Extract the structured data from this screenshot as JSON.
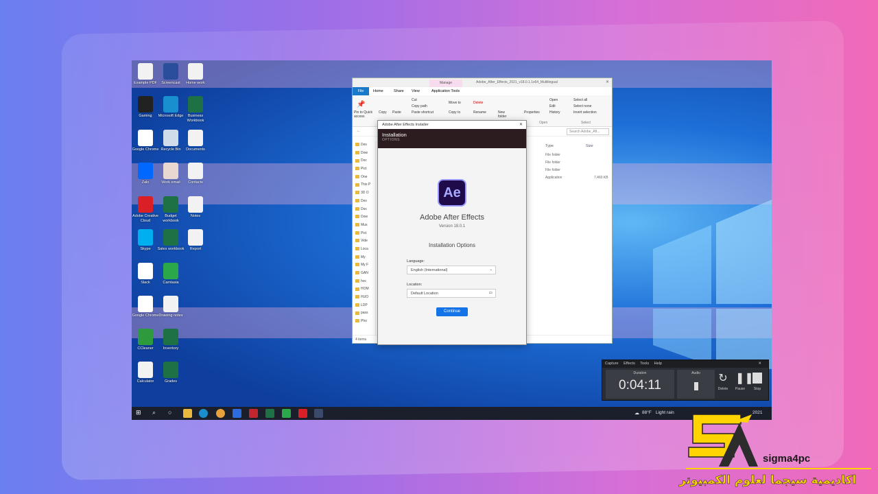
{
  "desktop": {
    "icons": [
      {
        "label": "Example PDF",
        "color": "#f2f2f2"
      },
      {
        "label": "Screencast",
        "color": "#2a4d9c"
      },
      {
        "label": "Home work",
        "color": "#f2f2f2"
      },
      {
        "label": "Gaming",
        "color": "#222222"
      },
      {
        "label": "Microsoft Edge",
        "color": "#1a8fd0"
      },
      {
        "label": "Business Workbook",
        "color": "#1e7145"
      },
      {
        "label": "Google Chrome",
        "color": "#ffffff"
      },
      {
        "label": "Recycle Bin",
        "color": "#d0dcea"
      },
      {
        "label": "Documents",
        "color": "#f2f2f2"
      },
      {
        "label": "Zalo",
        "color": "#0068ff"
      },
      {
        "label": "Work email",
        "color": "#e9d7d2"
      },
      {
        "label": "Contacts",
        "color": "#f2f2f2"
      },
      {
        "label": "Adobe Creative Cloud",
        "color": "#da1f26"
      },
      {
        "label": "Budget workbook",
        "color": "#1e7145"
      },
      {
        "label": "Notes",
        "color": "#f2f2f2"
      },
      {
        "label": "Skype",
        "color": "#00aff0"
      },
      {
        "label": "Sales workbook",
        "color": "#1e7145"
      },
      {
        "label": "Report",
        "color": "#f2f2f2"
      },
      {
        "label": "Slack",
        "color": "#ffffff"
      },
      {
        "label": "Camtasia",
        "color": "#2aa84a"
      },
      {
        "label": "Google Chrome",
        "color": "#ffffff"
      },
      {
        "label": "Drawing notes",
        "color": "#f2f2f2"
      },
      {
        "label": "CCleaner",
        "color": "#2d9a3e"
      },
      {
        "label": "Inventory",
        "color": "#1e7145"
      },
      {
        "label": "Calculator",
        "color": "#f2f2f2"
      },
      {
        "label": "Grades",
        "color": "#1e7145"
      }
    ]
  },
  "explorer": {
    "title": "Adobe_After_Effects_2021_v18.0.1.1x64_Multilingual",
    "manage_tab": "Manage",
    "tabs": [
      "File",
      "Home",
      "Share",
      "View",
      "Application Tools"
    ],
    "ribbon": {
      "pin": "Pin to Quick access",
      "copy": "Copy",
      "paste": "Paste",
      "cut": "Cut",
      "copy_path": "Copy path",
      "paste_shortcut": "Paste shortcut",
      "move_to": "Move to",
      "copy_to": "Copy to",
      "delete": "Delete",
      "rename": "Rename",
      "new_folder": "New folder",
      "properties": "Properties",
      "open": "Open",
      "edit": "Edit",
      "history": "History",
      "select_all": "Select all",
      "select_none": "Select none",
      "invert_selection": "Invert selection",
      "group_open": "Open",
      "group_select": "Select"
    },
    "search_placeholder": "Search Adobe_Aft...",
    "columns": {
      "type": "Type",
      "size": "Size"
    },
    "rows": [
      {
        "type": "File folder",
        "size": ""
      },
      {
        "type": "File folder",
        "size": ""
      },
      {
        "type": "File folder",
        "size": ""
      },
      {
        "type": "Application",
        "size": "7,460 KB"
      }
    ],
    "nav": [
      "Des",
      "Dow",
      "Doc",
      "Pict",
      "One",
      "This P",
      "3D O",
      "Des",
      "Doc",
      "Dow",
      "Mus",
      "Pict",
      "Vide",
      "Loca",
      "My",
      "My F",
      "GAN",
      "hoc",
      "HOM",
      "HUO",
      "LDP",
      "pass",
      "Pho"
    ],
    "status": "4 items"
  },
  "installer": {
    "window_title": "Adobe After Effects Installer",
    "header": "Installation",
    "subheader": "OPTIONS",
    "app_icon": "Ae",
    "app_name": "Adobe After Effects",
    "version": "Version 18.0.1",
    "options_title": "Installation Options",
    "language_label": "Language:",
    "language_value": "English (International)",
    "location_label": "Location:",
    "location_value": "Default Location",
    "continue": "Continue"
  },
  "recorder": {
    "menu": [
      "Capture",
      "Effects",
      "Tools",
      "Help"
    ],
    "duration_label": "Duration",
    "duration": "0:04:11",
    "audio_label": "Audio",
    "delete": "Delete",
    "pause": "Pause",
    "stop": "Stop"
  },
  "taskbar": {
    "weather": "88°F",
    "condition": "Light rain",
    "date": "2021"
  },
  "branding": {
    "name": "sigma4pc",
    "arabic": "اكاديمية سيجما لعلوم الكمبيوتر",
    "accent": "#ffd400"
  }
}
